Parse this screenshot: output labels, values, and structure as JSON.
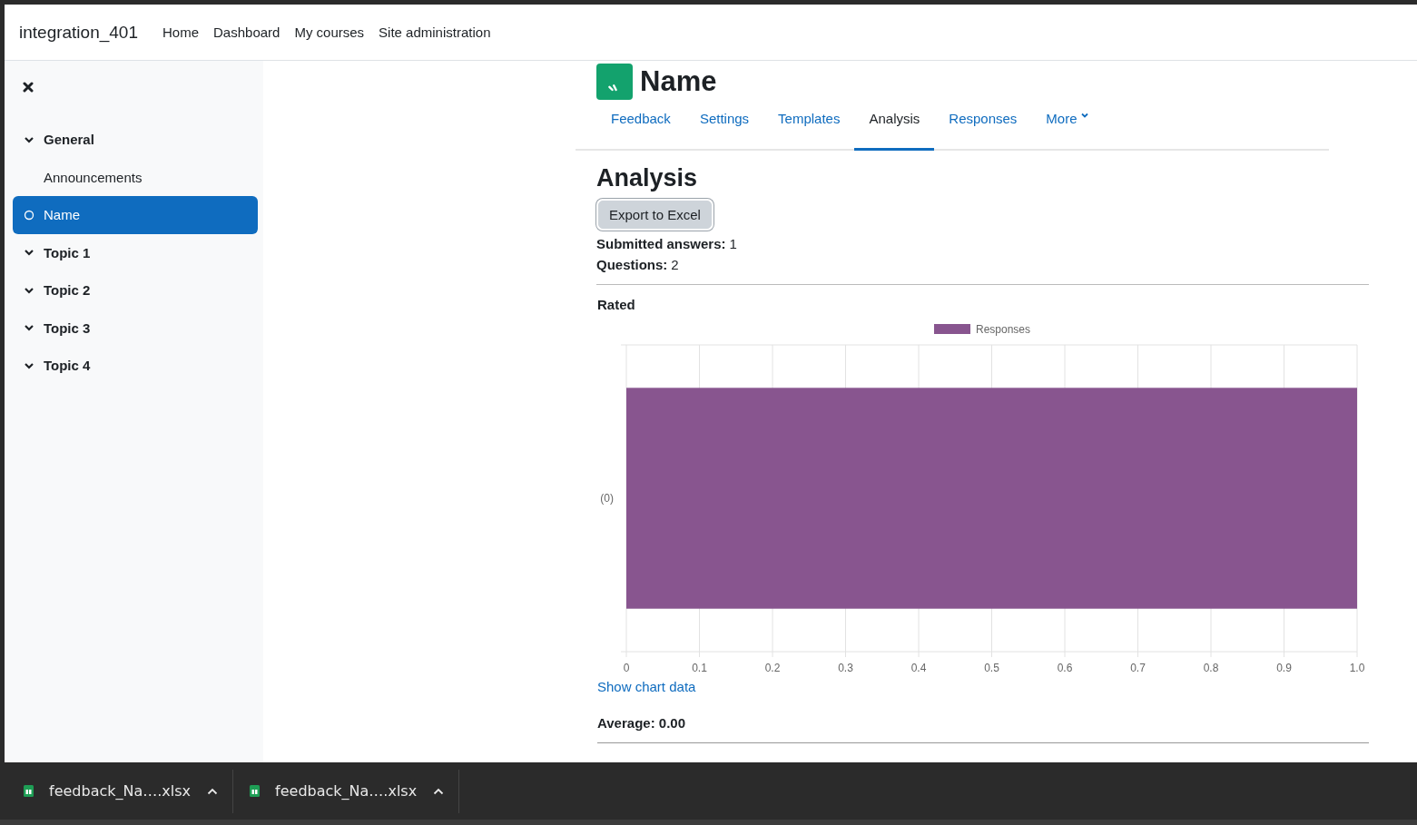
{
  "navbar": {
    "site_name": "integration_401",
    "links": [
      {
        "label": "Home"
      },
      {
        "label": "Dashboard"
      },
      {
        "label": "My courses"
      },
      {
        "label": "Site administration"
      }
    ]
  },
  "sidebar": {
    "sections": [
      {
        "title": "General",
        "expanded": true,
        "children": [
          {
            "label": "Announcements",
            "kind": "page",
            "selected": false
          },
          {
            "label": "Name",
            "kind": "activity",
            "selected": true
          }
        ]
      },
      {
        "title": "Topic 1",
        "expanded": true
      },
      {
        "title": "Topic 2",
        "expanded": true
      },
      {
        "title": "Topic 3",
        "expanded": true
      },
      {
        "title": "Topic 4",
        "expanded": true
      }
    ]
  },
  "activity": {
    "title": "Name",
    "tabs": [
      {
        "label": "Feedback",
        "kind": "tab",
        "selected": false
      },
      {
        "label": "Settings",
        "kind": "tab",
        "selected": false
      },
      {
        "label": "Templates",
        "kind": "tab",
        "selected": false
      },
      {
        "label": "Analysis",
        "kind": "tab",
        "selected": true
      },
      {
        "label": "Responses",
        "kind": "tab",
        "selected": false
      },
      {
        "label": "More",
        "kind": "menu",
        "selected": false
      }
    ],
    "heading": "Analysis",
    "export_button": "Export to Excel",
    "stats": [
      {
        "label": "Submitted answers:",
        "value": "1"
      },
      {
        "label": "Questions:",
        "value": "2"
      }
    ],
    "questions": [
      {
        "title": "Rated",
        "chart_data": {
          "type": "bar",
          "orientation": "horizontal",
          "categories": [
            "(0)"
          ],
          "series": [
            {
              "name": "Responses",
              "color": "#88558f",
              "values": [
                1
              ]
            }
          ],
          "xlim": [
            0,
            1
          ],
          "grid": true,
          "xticks": [
            0,
            0.1,
            0.2,
            0.3,
            0.4,
            0.5,
            0.6,
            0.7,
            0.8,
            0.9,
            {
              "value": 1,
              "label": "1.0"
            }
          ]
        },
        "show_data_link": "Show chart data",
        "average": "Average: 0.00"
      }
    ]
  },
  "downloads": [
    {
      "filename": "feedback_Na….xlsx"
    },
    {
      "filename": "feedback_Na….xlsx"
    }
  ]
}
